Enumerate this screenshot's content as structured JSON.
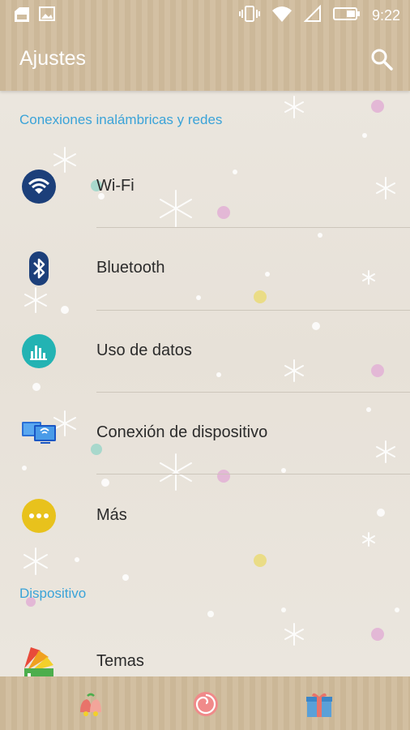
{
  "status_bar": {
    "time": "9:22",
    "icons": [
      "sim-card-icon",
      "image-icon",
      "vibrate-icon",
      "wifi-icon",
      "no-signal-icon",
      "battery-icon"
    ]
  },
  "header": {
    "title": "Ajustes",
    "search_icon": "search-icon"
  },
  "sections": [
    {
      "title": "Conexiones inalámbricas y redes",
      "items": [
        {
          "label": "Wi-Fi",
          "icon": "wifi-icon"
        },
        {
          "label": "Bluetooth",
          "icon": "bluetooth-icon"
        },
        {
          "label": "Uso de datos",
          "icon": "data-usage-icon"
        },
        {
          "label": "Conexión de dispositivo",
          "icon": "device-connection-icon"
        },
        {
          "label": "Más",
          "icon": "more-icon"
        }
      ]
    },
    {
      "title": "Dispositivo",
      "items": [
        {
          "label": "Temas",
          "icon": "themes-icon"
        }
      ]
    }
  ],
  "dock": {
    "icons": [
      "bells-icon",
      "lollipop-icon",
      "gift-icon"
    ]
  },
  "colors": {
    "accent": "#3aa3d8",
    "header_bg": "#ccb899",
    "content_bg": "#e9e4dc",
    "wifi_icon_bg": "#1c3f7a",
    "data_icon_bg": "#23b3b3",
    "more_icon_bg": "#e8c21c"
  }
}
